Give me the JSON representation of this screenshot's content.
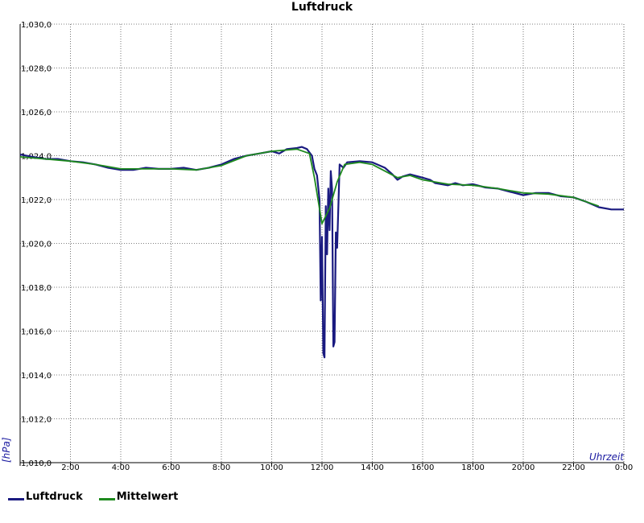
{
  "chart_data": {
    "type": "line",
    "title": "Luftdruck",
    "ylabel": "[hPa]",
    "xlabel": "Uhrzeit",
    "ylim": [
      1010,
      1030
    ],
    "xlim": [
      0,
      24
    ],
    "y_ticks": [
      "1,010,0",
      "1,012,0",
      "1,014,0",
      "1,016,0",
      "1,018,0",
      "1,020,0",
      "1,022,0",
      "1,024,0",
      "1,026,0",
      "1,028,0",
      "1,030,0"
    ],
    "x_ticks": [
      "2:00",
      "4:00",
      "6:00",
      "8:00",
      "10:00",
      "12:00",
      "14:00",
      "16:00",
      "18:00",
      "20:00",
      "22:00",
      "0:00"
    ],
    "grid": true,
    "legend_position": "bottom-left",
    "series": [
      {
        "name": "Luftdruck",
        "color": "#1a1a80",
        "points": [
          [
            0.0,
            1024.05
          ],
          [
            0.5,
            1023.95
          ],
          [
            1.0,
            1023.85
          ],
          [
            1.5,
            1023.85
          ],
          [
            2.0,
            1023.75
          ],
          [
            2.5,
            1023.7
          ],
          [
            3.0,
            1023.6
          ],
          [
            3.5,
            1023.45
          ],
          [
            4.0,
            1023.35
          ],
          [
            4.5,
            1023.35
          ],
          [
            5.0,
            1023.45
          ],
          [
            5.5,
            1023.4
          ],
          [
            6.0,
            1023.4
          ],
          [
            6.5,
            1023.45
          ],
          [
            7.0,
            1023.35
          ],
          [
            7.5,
            1023.45
          ],
          [
            8.0,
            1023.6
          ],
          [
            8.5,
            1023.85
          ],
          [
            9.0,
            1024.0
          ],
          [
            9.5,
            1024.1
          ],
          [
            10.0,
            1024.2
          ],
          [
            10.3,
            1024.1
          ],
          [
            10.6,
            1024.3
          ],
          [
            11.0,
            1024.35
          ],
          [
            11.2,
            1024.4
          ],
          [
            11.4,
            1024.3
          ],
          [
            11.6,
            1024.0
          ],
          [
            11.7,
            1023.4
          ],
          [
            11.8,
            1023.1
          ],
          [
            11.9,
            1022.0
          ],
          [
            11.95,
            1017.4
          ],
          [
            12.0,
            1020.3
          ],
          [
            12.05,
            1015.0
          ],
          [
            12.1,
            1014.8
          ],
          [
            12.15,
            1021.7
          ],
          [
            12.2,
            1019.5
          ],
          [
            12.25,
            1022.5
          ],
          [
            12.3,
            1020.6
          ],
          [
            12.35,
            1023.3
          ],
          [
            12.4,
            1022.5
          ],
          [
            12.45,
            1015.3
          ],
          [
            12.5,
            1015.5
          ],
          [
            12.55,
            1020.5
          ],
          [
            12.6,
            1019.8
          ],
          [
            12.7,
            1023.6
          ],
          [
            12.85,
            1023.45
          ],
          [
            13.0,
            1023.7
          ],
          [
            13.5,
            1023.75
          ],
          [
            14.0,
            1023.7
          ],
          [
            14.5,
            1023.45
          ],
          [
            14.8,
            1023.15
          ],
          [
            15.0,
            1022.9
          ],
          [
            15.2,
            1023.05
          ],
          [
            15.5,
            1023.15
          ],
          [
            16.0,
            1023.0
          ],
          [
            16.3,
            1022.9
          ],
          [
            16.5,
            1022.75
          ],
          [
            17.0,
            1022.65
          ],
          [
            17.3,
            1022.75
          ],
          [
            17.6,
            1022.65
          ],
          [
            18.0,
            1022.7
          ],
          [
            18.5,
            1022.55
          ],
          [
            19.0,
            1022.5
          ],
          [
            19.5,
            1022.35
          ],
          [
            20.0,
            1022.2
          ],
          [
            20.5,
            1022.3
          ],
          [
            21.0,
            1022.3
          ],
          [
            21.5,
            1022.15
          ],
          [
            22.0,
            1022.1
          ],
          [
            22.5,
            1021.9
          ],
          [
            23.0,
            1021.65
          ],
          [
            23.5,
            1021.55
          ],
          [
            24.0,
            1021.55
          ]
        ]
      },
      {
        "name": "Mittelwert",
        "color": "#1e8a1e",
        "points": [
          [
            0.0,
            1023.95
          ],
          [
            1.0,
            1023.85
          ],
          [
            2.0,
            1023.75
          ],
          [
            3.0,
            1023.6
          ],
          [
            4.0,
            1023.4
          ],
          [
            5.0,
            1023.4
          ],
          [
            6.0,
            1023.4
          ],
          [
            7.0,
            1023.35
          ],
          [
            8.0,
            1023.55
          ],
          [
            9.0,
            1024.0
          ],
          [
            10.0,
            1024.2
          ],
          [
            11.0,
            1024.3
          ],
          [
            11.5,
            1024.1
          ],
          [
            11.7,
            1023.0
          ],
          [
            12.0,
            1020.9
          ],
          [
            12.3,
            1021.6
          ],
          [
            12.6,
            1022.8
          ],
          [
            12.9,
            1023.6
          ],
          [
            13.5,
            1023.7
          ],
          [
            14.0,
            1023.6
          ],
          [
            14.5,
            1023.3
          ],
          [
            15.0,
            1023.0
          ],
          [
            15.5,
            1023.1
          ],
          [
            16.0,
            1022.9
          ],
          [
            17.0,
            1022.7
          ],
          [
            18.0,
            1022.65
          ],
          [
            19.0,
            1022.5
          ],
          [
            20.0,
            1022.3
          ],
          [
            21.0,
            1022.25
          ],
          [
            22.0,
            1022.1
          ],
          [
            22.5,
            1021.9
          ],
          [
            23.0,
            1021.7
          ]
        ]
      }
    ]
  }
}
